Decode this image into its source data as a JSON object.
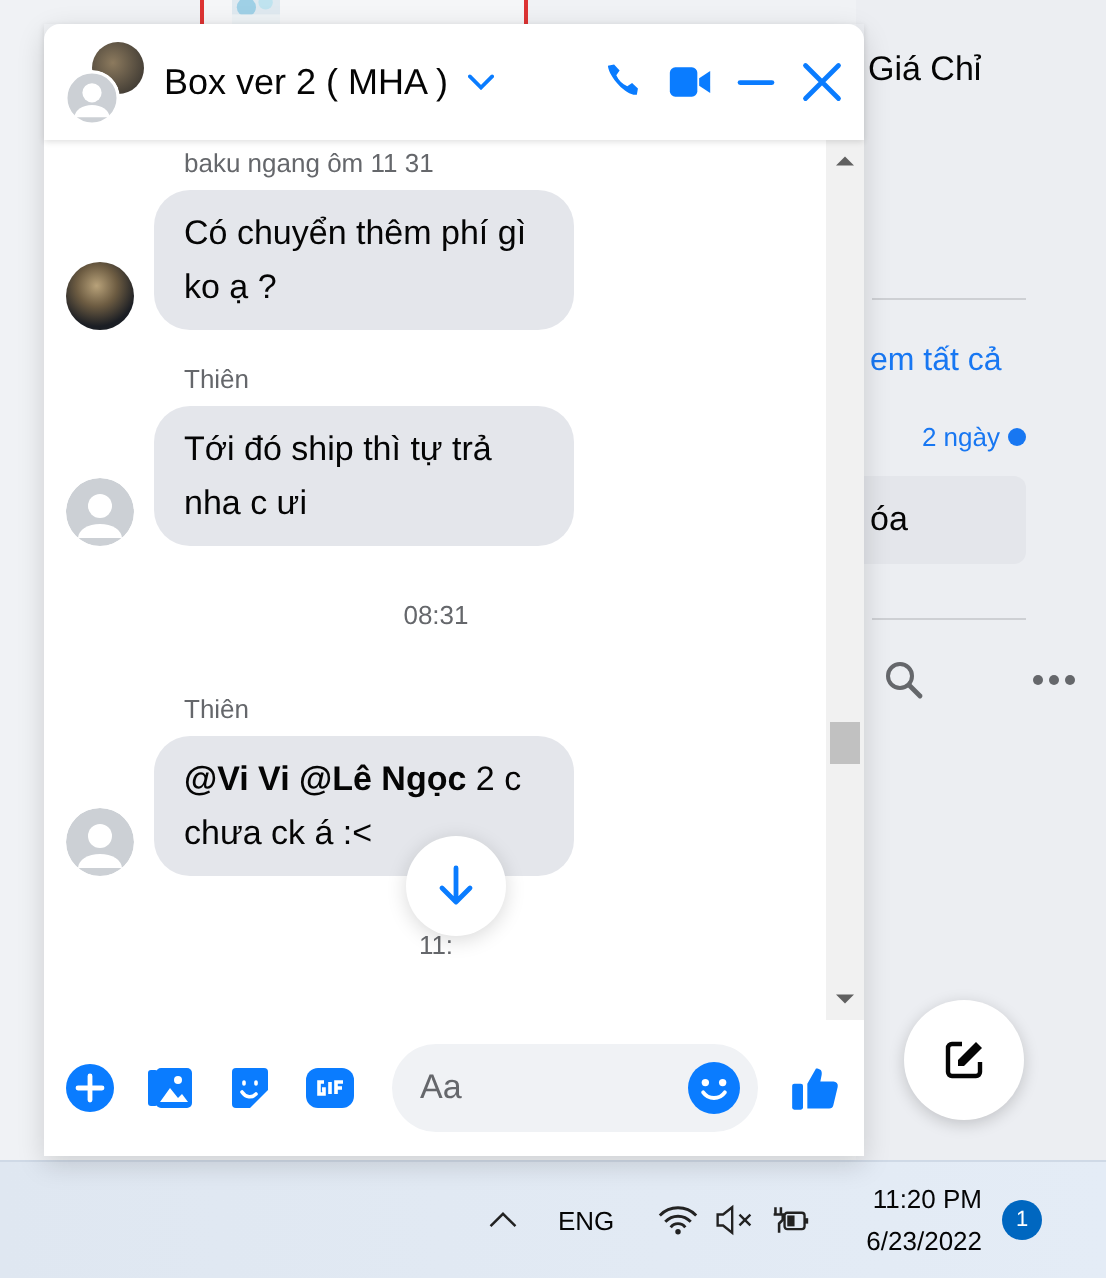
{
  "background_page": {
    "heading": "Giá Chỉ",
    "see_all": "em tất cả",
    "time": "2 ngày",
    "unread": true,
    "button": "óa"
  },
  "chat": {
    "title": "Box ver 2 ( MHA )",
    "messages": [
      {
        "kind": "message",
        "sender": "baku ngang ôm 11 31",
        "text": "Có chuyển thêm phí gì ko ạ ?",
        "photo_avatar": true
      },
      {
        "kind": "message",
        "sender": "Thiên",
        "text": "Tới đó ship thì tự trả nha c ưi",
        "photo_avatar": false
      },
      {
        "kind": "timestamp",
        "text": "08:31"
      },
      {
        "kind": "message",
        "sender": "Thiên",
        "text": "**@Vi Vi @Lê Ngọc** 2 c chưa ck á :<",
        "photo_avatar": false
      },
      {
        "kind": "timestamp",
        "text": "11:"
      }
    ],
    "composer": {
      "placeholder": "Aa"
    }
  },
  "taskbar": {
    "language": "ENG",
    "time": "11:20 PM",
    "date": "6/23/2022",
    "notifications": "1"
  }
}
